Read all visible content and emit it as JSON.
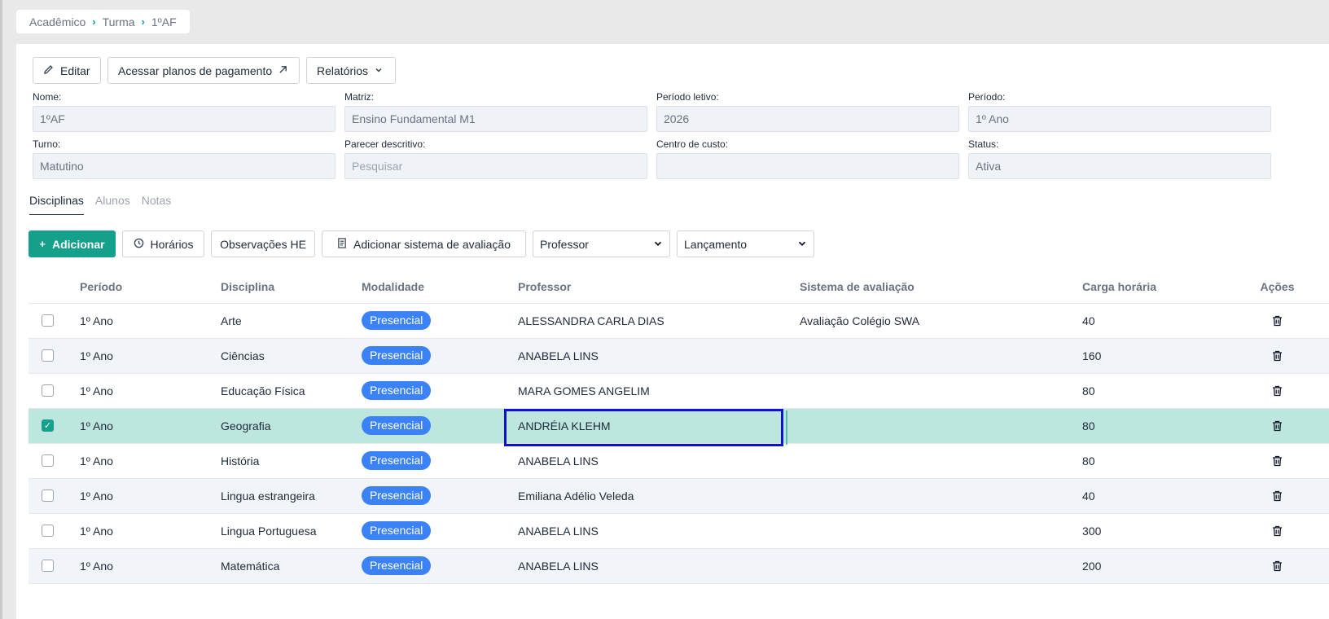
{
  "breadcrumb": {
    "items": [
      "Acadêmico",
      "Turma",
      "1ºAF"
    ]
  },
  "toolbar": {
    "edit_label": "Editar",
    "plans_label": "Acessar planos de pagamento",
    "reports_label": "Relatórios"
  },
  "fields": {
    "nome": {
      "label": "Nome:",
      "value": "1ºAF"
    },
    "matriz": {
      "label": "Matriz:",
      "value": "Ensino Fundamental M1"
    },
    "periodo_letivo": {
      "label": "Período letivo:",
      "value": "2026"
    },
    "periodo": {
      "label": "Período:",
      "value": "1º Ano"
    },
    "turno": {
      "label": "Turno:",
      "value": "Matutino"
    },
    "parecer": {
      "label": "Parecer descritivo:",
      "placeholder": "Pesquisar"
    },
    "centro_custo": {
      "label": "Centro de custo:",
      "value": ""
    },
    "status": {
      "label": "Status:",
      "value": "Ativa"
    }
  },
  "tabs": [
    "Disciplinas",
    "Alunos",
    "Notas"
  ],
  "actions": {
    "add_label": "Adicionar",
    "schedule_label": "Horários",
    "notes_label": "Observações HE",
    "eval_label": "Adicionar sistema de avaliação",
    "professor_select": "Professor",
    "launch_select": "Lançamento"
  },
  "table": {
    "headers": [
      "Período",
      "Disciplina",
      "Modalidade",
      "Professor",
      "Sistema de avaliação",
      "Carga horária",
      "Ações"
    ],
    "rows": [
      {
        "checked": false,
        "periodo": "1º Ano",
        "disciplina": "Arte",
        "modalidade": "Presencial",
        "professor": "ALESSANDRA CARLA DIAS",
        "sistema": "Avaliação Colégio SWA",
        "carga": "40"
      },
      {
        "checked": false,
        "periodo": "1º Ano",
        "disciplina": "Ciências",
        "modalidade": "Presencial",
        "professor": "ANABELA LINS",
        "sistema": "",
        "carga": "160"
      },
      {
        "checked": false,
        "periodo": "1º Ano",
        "disciplina": "Educação Física",
        "modalidade": "Presencial",
        "professor": "MARA GOMES ANGELIM",
        "sistema": "",
        "carga": "80"
      },
      {
        "checked": true,
        "periodo": "1º Ano",
        "disciplina": "Geografia",
        "modalidade": "Presencial",
        "professor": "ANDRÉIA KLEHM",
        "sistema": "",
        "carga": "80"
      },
      {
        "checked": false,
        "periodo": "1º Ano",
        "disciplina": "História",
        "modalidade": "Presencial",
        "professor": "ANABELA LINS",
        "sistema": "",
        "carga": "80"
      },
      {
        "checked": false,
        "periodo": "1º Ano",
        "disciplina": "Lingua estrangeira",
        "modalidade": "Presencial",
        "professor": "Emiliana Adélio Veleda",
        "sistema": "",
        "carga": "40"
      },
      {
        "checked": false,
        "periodo": "1º Ano",
        "disciplina": "Lingua Portuguesa",
        "modalidade": "Presencial",
        "professor": "ANABELA LINS",
        "sistema": "",
        "carga": "300"
      },
      {
        "checked": false,
        "periodo": "1º Ano",
        "disciplina": "Matemática",
        "modalidade": "Presencial",
        "professor": "ANABELA LINS",
        "sistema": "",
        "carga": "200"
      }
    ]
  },
  "colors": {
    "accent": "#14a08a",
    "badge": "#3b82f6",
    "selected_row": "#bde6df",
    "highlight_border": "#0b12d4"
  }
}
